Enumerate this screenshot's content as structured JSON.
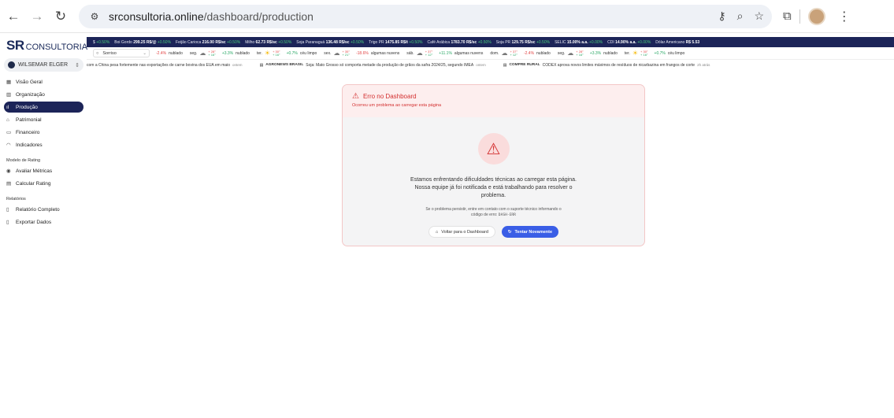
{
  "browser": {
    "url_host": "srconsultoria.online",
    "url_path": "/dashboard/production"
  },
  "brand": {
    "sr": "SR",
    "consultoria": "CONSULTORIA"
  },
  "user": {
    "name": "WILSEMAR ELGER"
  },
  "sidebar": {
    "items": [
      {
        "label": "Visão Geral",
        "icon": "grid-icon"
      },
      {
        "label": "Organização",
        "icon": "building-icon"
      },
      {
        "label": "Produção",
        "icon": "chart-icon"
      },
      {
        "label": "Patrimonial",
        "icon": "bank-icon"
      },
      {
        "label": "Financeiro",
        "icon": "card-icon"
      },
      {
        "label": "Indicadores",
        "icon": "gauge-icon"
      }
    ],
    "rating_section": "Modelo de Rating",
    "rating_items": [
      {
        "label": "Avaliar Métricas",
        "icon": "target-icon"
      },
      {
        "label": "Calcular Rating",
        "icon": "calculator-icon"
      }
    ],
    "reports_section": "Relatórios",
    "report_items": [
      {
        "label": "Relatório Completo",
        "icon": "document-icon"
      },
      {
        "label": "Exportar Dados",
        "icon": "export-icon"
      }
    ]
  },
  "ticker": [
    {
      "name": "$",
      "value": "",
      "pct": "+0.50%"
    },
    {
      "name": "Boi Gordo",
      "value": "299.25 R$/@",
      "pct": "+0.50%"
    },
    {
      "name": "Feijão Carioca",
      "value": "216.00 R$/sc",
      "pct": "+0.50%"
    },
    {
      "name": "Milho",
      "value": "62.73 R$/sc",
      "pct": "+0.50%"
    },
    {
      "name": "Soja Paranaguá",
      "value": "136.48 R$/sc",
      "pct": "+0.50%"
    },
    {
      "name": "Trigo PR",
      "value": "1475.85 R$/t",
      "pct": "+0.50%"
    },
    {
      "name": "Café Arábica",
      "value": "1783.70 R$/sc",
      "pct": "+0.50%"
    },
    {
      "name": "Soja PR",
      "value": "129.75 R$/sc",
      "pct": "+0.50%"
    },
    {
      "name": "SELIC",
      "value": "15.00% a.a.",
      "pct": "+0.00%"
    },
    {
      "name": "CDI",
      "value": "14.90% a.a.",
      "pct": "+0.00%"
    },
    {
      "name": "Dólar Americano",
      "value": "R$ 5.53",
      "pct": ""
    }
  ],
  "weather": {
    "city": "Sorriso",
    "days": [
      {
        "pct": "-2.4%",
        "desc": "nublado",
        "day": "seg.",
        "hi": "+ 28°",
        "lo": "+ 16°",
        "icon": "cloud-icon",
        "neg": true
      },
      {
        "pct": "+3.3%",
        "desc": "nublado",
        "day": "ter.",
        "hi": "+ 30°",
        "lo": "+ 16°",
        "icon": "sun-icon",
        "neg": false
      },
      {
        "pct": "+0.7%",
        "desc": "céu limpo",
        "day": "sex.",
        "hi": "+ 35°",
        "lo": "+ 21°",
        "icon": "cloud-icon",
        "neg": false
      },
      {
        "pct": "-18.6%",
        "desc": "algumas nuvens",
        "day": "sáb.",
        "hi": "+ 37°",
        "lo": "+ 12°",
        "icon": "cloud-icon",
        "neg": true
      },
      {
        "pct": "+11.1%",
        "desc": "algumas nuvens",
        "day": "dom.",
        "hi": "+ 37°",
        "lo": "+ 12°",
        "icon": "cloud-icon",
        "neg": false
      },
      {
        "pct": "-2.4%",
        "desc": "nublado",
        "day": "seg.",
        "hi": "+ 28°",
        "lo": "+ 16°",
        "icon": "cloud-icon",
        "neg": true
      },
      {
        "pct": "+3.3%",
        "desc": "nublado",
        "day": "ter.",
        "hi": "+ 30°",
        "lo": "+ 16°",
        "icon": "sun-icon",
        "neg": false
      },
      {
        "pct": "+0.7%",
        "desc": "céu limpo",
        "day": "",
        "hi": "",
        "lo": "",
        "icon": "",
        "neg": false
      }
    ]
  },
  "news": [
    {
      "source": "",
      "text": "com a China pesa fortemente nas exportações de carne bovina dos EUA em maio",
      "time": "ontem"
    },
    {
      "source": "AGRONEWS BRASIL",
      "text": "Soja: Mato Grosso só comporta metade da produção de grãos da safra 2024/25, segundo IMEA",
      "time": "ontem"
    },
    {
      "source": "COMPRE RURAL",
      "text": "CODEX aprova novos limites máximos de resíduos de nicarbazina em frangos de corte",
      "time": "2h atrás"
    }
  ],
  "error": {
    "title": "Erro no Dashboard",
    "subtitle": "Ocorreu um problema ao carregar esta página",
    "message": "Estamos enfrentando dificuldades técnicas ao carregar esta página. Nossa equipe já foi notificada e está trabalhando para resolver o problema.",
    "help": "Se o problema persistir, entre em contato com o suporte técnico informando o código de erro:",
    "code": "DASH-ERR",
    "back_label": "Voltar para o Dashboard",
    "retry_label": "Tentar Novamente"
  }
}
